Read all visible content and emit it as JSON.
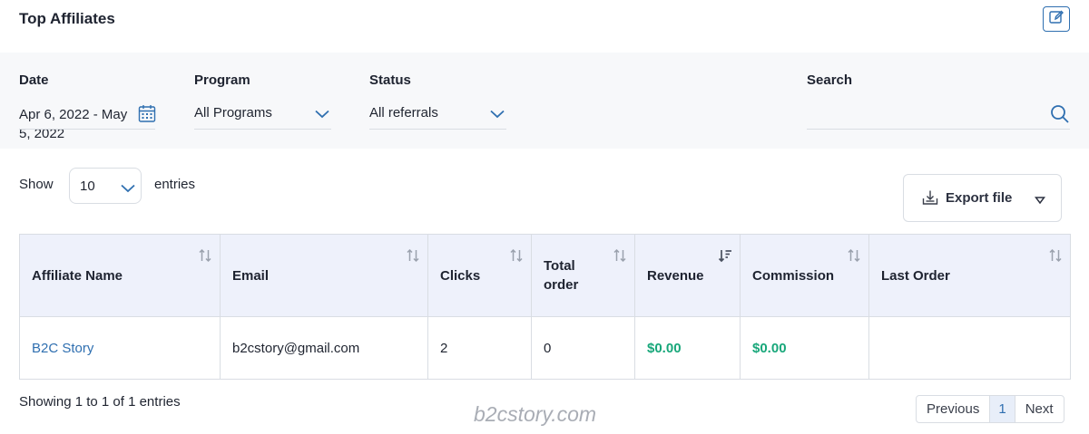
{
  "header": {
    "title": "Top Affiliates",
    "edit_icon": "edit-icon"
  },
  "filters": {
    "date": {
      "label": "Date",
      "value": "Apr 6, 2022 - May 5, 2022",
      "icon": "calendar-icon"
    },
    "program": {
      "label": "Program",
      "value": "All Programs"
    },
    "status": {
      "label": "Status",
      "value": "All referrals"
    },
    "search": {
      "label": "Search",
      "placeholder": ""
    }
  },
  "table_controls": {
    "show_label": "Show",
    "entries_value": "10",
    "entries_label": "entries",
    "export_label": "Export file"
  },
  "table": {
    "columns": [
      "Affiliate Name",
      "Email",
      "Clicks",
      "Total order",
      "Revenue",
      "Commission",
      "Last Order"
    ],
    "rows": [
      {
        "affiliate_name": "B2C Story",
        "email": "b2cstory@gmail.com",
        "clicks": "2",
        "total_order": "0",
        "revenue": "$0.00",
        "commission": "$0.00",
        "last_order": ""
      }
    ]
  },
  "footer": {
    "showing_text": "Showing 1 to 1 of 1 entries",
    "previous": "Previous",
    "current_page": "1",
    "next": "Next"
  },
  "watermark": "b2cstory.com",
  "colors": {
    "accent": "#2f6fb0",
    "money": "#18a77a",
    "header_bg": "#eef1fb"
  }
}
